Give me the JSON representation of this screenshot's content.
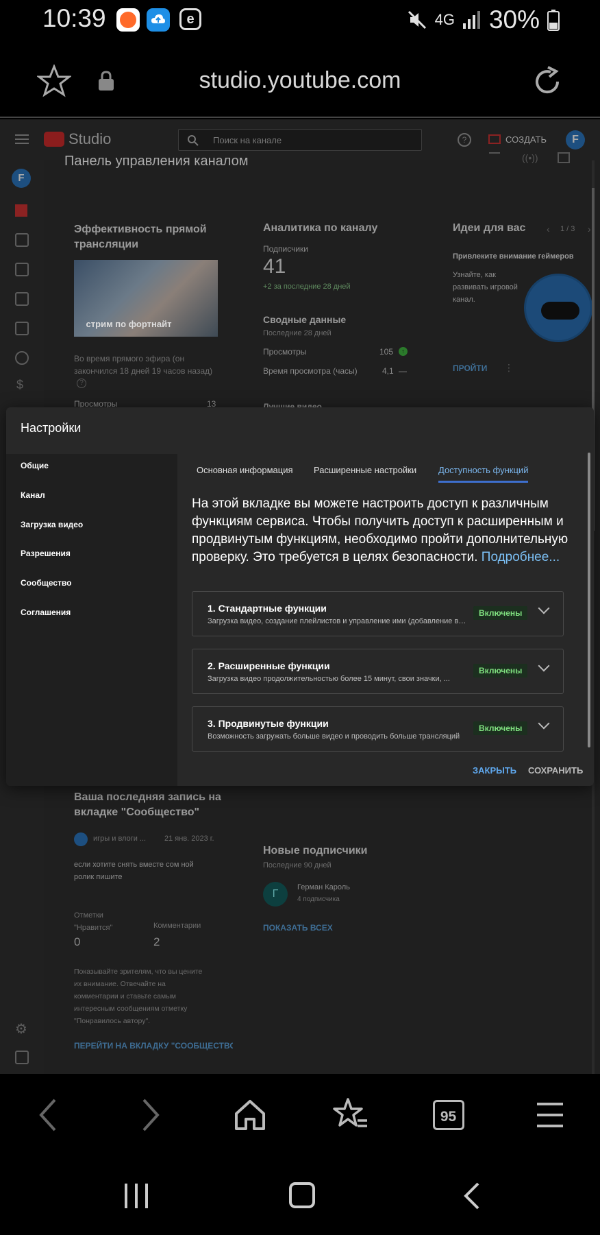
{
  "status_bar": {
    "time": "10:39",
    "network": "4G",
    "battery": "30%"
  },
  "browser": {
    "url": "studio.youtube.com",
    "tabs_count": "95"
  },
  "studio": {
    "logo": "Studio",
    "search_placeholder": "Поиск на канале",
    "create_label": "СОЗДАТЬ",
    "avatar_letter": "F",
    "dashboard_title": "Панель управления каналом",
    "stream_card": {
      "title": "Эффективность прямой трансляции",
      "thumb_caption": "стрим по фортнайт",
      "note": "Во время прямого эфира (он закончился 18 дней 19 часов назад)",
      "views_label": "Просмотры",
      "views_value": "13"
    },
    "analytics_card": {
      "title": "Аналитика по каналу",
      "subs_label": "Подписчики",
      "subs_value": "41",
      "subs_delta": "+2 за последние 28 дней",
      "summary_title": "Сводные данные",
      "summary_period": "Последние 28 дней",
      "views_label": "Просмотры",
      "views_value": "105",
      "watch_label": "Время просмотра (часы)",
      "watch_value": "4,1",
      "watch_trend": "—",
      "best_label": "Лучшие видео"
    },
    "ideas_card": {
      "title": "Идеи для вас",
      "pager": "1 / 3",
      "headline": "Привлеките внимание геймеров",
      "text": "Узнайте, как развивать игровой канал.",
      "action": "ПРОЙТИ"
    },
    "community_card": {
      "title": "Ваша последняя запись на вкладке \"Сообщество\"",
      "author": "игры и влоги ...",
      "date": "21 янв. 2023 г.",
      "post": "если хотите снять вместе сом ной ролик пишите",
      "likes_label": "Отметки \"Нравится\"",
      "likes_value": "0",
      "comments_label": "Комментарии",
      "comments_value": "2",
      "tip": "Показывайте зрителям, что вы цените их внимание. Отвечайте на комментарии и ставьте самым интересным сообщениям отметку \"Понравилось автору\".",
      "link": "ПЕРЕЙТИ НА ВКЛАДКУ \"СООБЩЕСТВО"
    },
    "subscribers_card": {
      "title": "Новые подписчики",
      "period": "Последние 90 дней",
      "sub_initial": "Г",
      "sub_name": "Герман Кароль",
      "sub_count": "4 подписчика",
      "show_all": "ПОКАЗАТЬ ВСЕХ"
    }
  },
  "settings": {
    "title": "Настройки",
    "nav": [
      "Общие",
      "Канал",
      "Загрузка видео",
      "Разрешения",
      "Сообщество",
      "Соглашения"
    ],
    "tabs": [
      "Основная информация",
      "Расширенные настройки",
      "Доступность функций"
    ],
    "intro": "На этой вкладке вы можете настроить доступ к различным функциям сервиса. Чтобы получить доступ к расширенным и продвинутым функциям, необходимо пройти дополнительную проверку. Это требуется в целях безопасности.",
    "intro_link": "Подробнее...",
    "features": [
      {
        "title": "1. Стандартные функции",
        "desc": "Загрузка видео, создание плейлистов и управление ими (добавление видео)",
        "status": "Включены"
      },
      {
        "title": "2. Расширенные функции",
        "desc": "Загрузка видео продолжительностью более 15 минут, свои значки, ...",
        "status": "Включены"
      },
      {
        "title": "3. Продвинутые функции",
        "desc": "Возможность загружать больше видео и проводить больше трансляций",
        "status": "Включены"
      }
    ],
    "close_label": "ЗАКРЫТЬ",
    "save_label": "СОХРАНИТЬ"
  },
  "colors": {
    "accent_blue": "#7cb8f0",
    "enabled_green": "#7fe07f",
    "modal_bg": "#282828"
  }
}
